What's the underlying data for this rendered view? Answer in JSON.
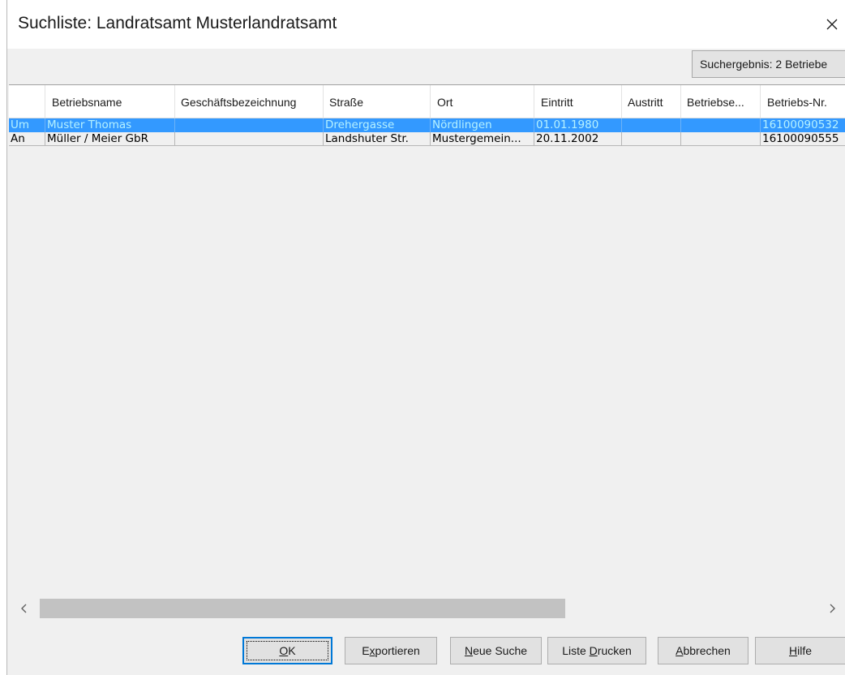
{
  "window": {
    "title": "Suchliste: Landratsamt Musterlandratsamt",
    "close_icon": "close-icon"
  },
  "result_summary": "Suchergebnis: 2 Betriebe",
  "table": {
    "columns": [
      "",
      "Betriebsname",
      "Geschäftsbezeichnung",
      "Straße",
      "Ort",
      "Eintritt",
      "Austritt",
      "Betriebse...",
      "Betriebs-Nr."
    ],
    "rows": [
      {
        "selected": true,
        "cells": [
          "Um",
          "Muster Thomas",
          "",
          "Drehergasse",
          "Nördlingen",
          "01.01.1980",
          "",
          "",
          "16100090532"
        ]
      },
      {
        "selected": false,
        "cells": [
          "An",
          "Müller / Meier GbR",
          "",
          "Landshuter Str.",
          "Mustergemein...",
          "20.11.2002",
          "",
          "",
          "16100090555"
        ]
      }
    ],
    "selection_color": "#3399ff"
  },
  "scrollbar": {
    "left_icon": "chevron-left-icon",
    "right_icon": "chevron-right-icon"
  },
  "buttons": [
    {
      "label": "OK",
      "mnemonic_index": 0,
      "default": true
    },
    {
      "label": "Exportieren",
      "mnemonic_index": 1,
      "default": false
    },
    {
      "label": "Neue Suche",
      "mnemonic_index": 0,
      "default": false
    },
    {
      "label": "Liste Drucken",
      "mnemonic_index": 6,
      "default": false
    },
    {
      "label": "Abbrechen",
      "mnemonic_index": 0,
      "default": false
    },
    {
      "label": "Hilfe",
      "mnemonic_index": 0,
      "default": false
    }
  ],
  "accent_color": "#0078d7"
}
